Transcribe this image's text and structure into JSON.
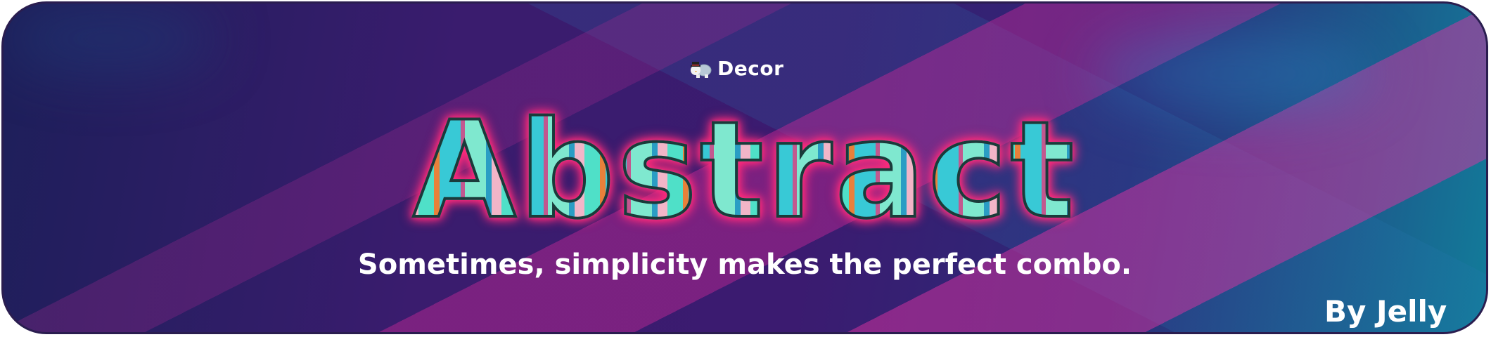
{
  "banner": {
    "brand_label": "Decor",
    "brand_icon": "turtle-top-hat-icon",
    "title": "Abstract",
    "subtitle": "Sometimes, simplicity makes the perfect combo.",
    "author": "By Jelly",
    "colors": {
      "background_dark": "#1d1f5a",
      "background_purple": "#3b1b70",
      "accent_teal": "#127c9a",
      "title_glow": "#ff2a7a",
      "title_fill": "#4fe0c8"
    }
  }
}
